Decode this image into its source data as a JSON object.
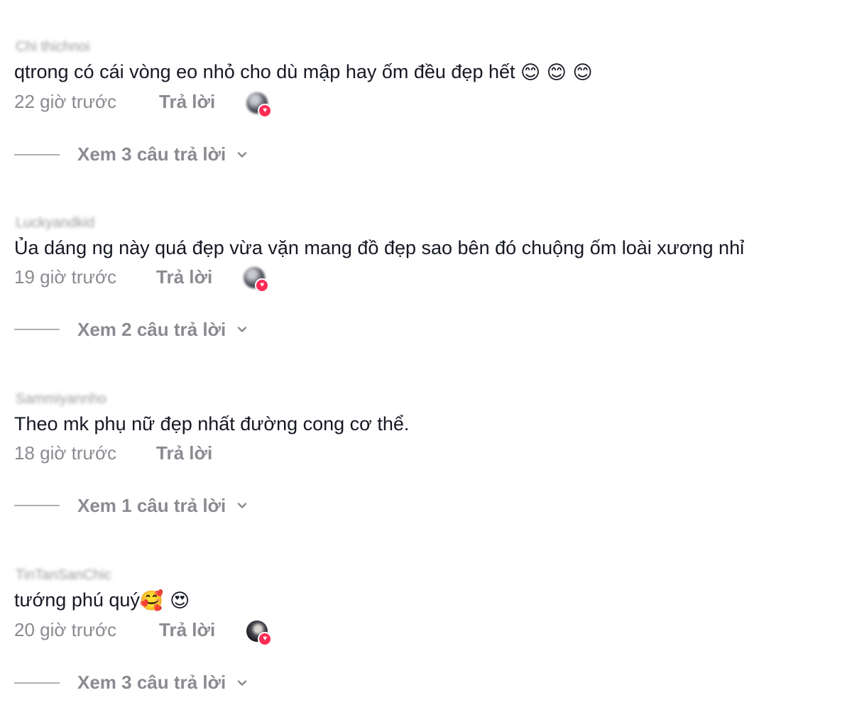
{
  "comments": [
    {
      "username": "Chi thichnoi",
      "text": "qtrong có cái vòng eo nhỏ cho dù mập hay ốm đều đẹp hết",
      "emojis": "😊 😊 😊",
      "time": "22 giờ trước",
      "reply_label": "Trả lời",
      "view_replies": "Xem 3 câu trả lời"
    },
    {
      "username": "Luckyandkid",
      "text": "Ủa dáng ng này quá đẹp vừa vặn mang đồ đẹp sao bên đó chuộng ốm loài xương nhỉ",
      "emojis": "",
      "time": "19 giờ trước",
      "reply_label": "Trả lời",
      "view_replies": "Xem 2 câu trả lời"
    },
    {
      "username": "Sammiyannho",
      "text": "Theo mk phụ nữ đẹp nhất đường cong cơ thể.",
      "emojis": "",
      "time": "18 giờ trước",
      "reply_label": "Trả lời",
      "view_replies": "Xem 1 câu trả lời"
    },
    {
      "username": "TinTanSanChic",
      "text": "tướng phú quý",
      "emojis": "🥰 😍",
      "time": "20 giờ trước",
      "reply_label": "Trả lời",
      "view_replies": "Xem 3 câu trả lời"
    }
  ],
  "colors": {
    "text": "#161823",
    "secondary": "#8a8b91",
    "heart_badge": "#fe2c55"
  },
  "icons": {
    "expand": "chevron-down-icon",
    "liked_badge": "heart-icon"
  }
}
